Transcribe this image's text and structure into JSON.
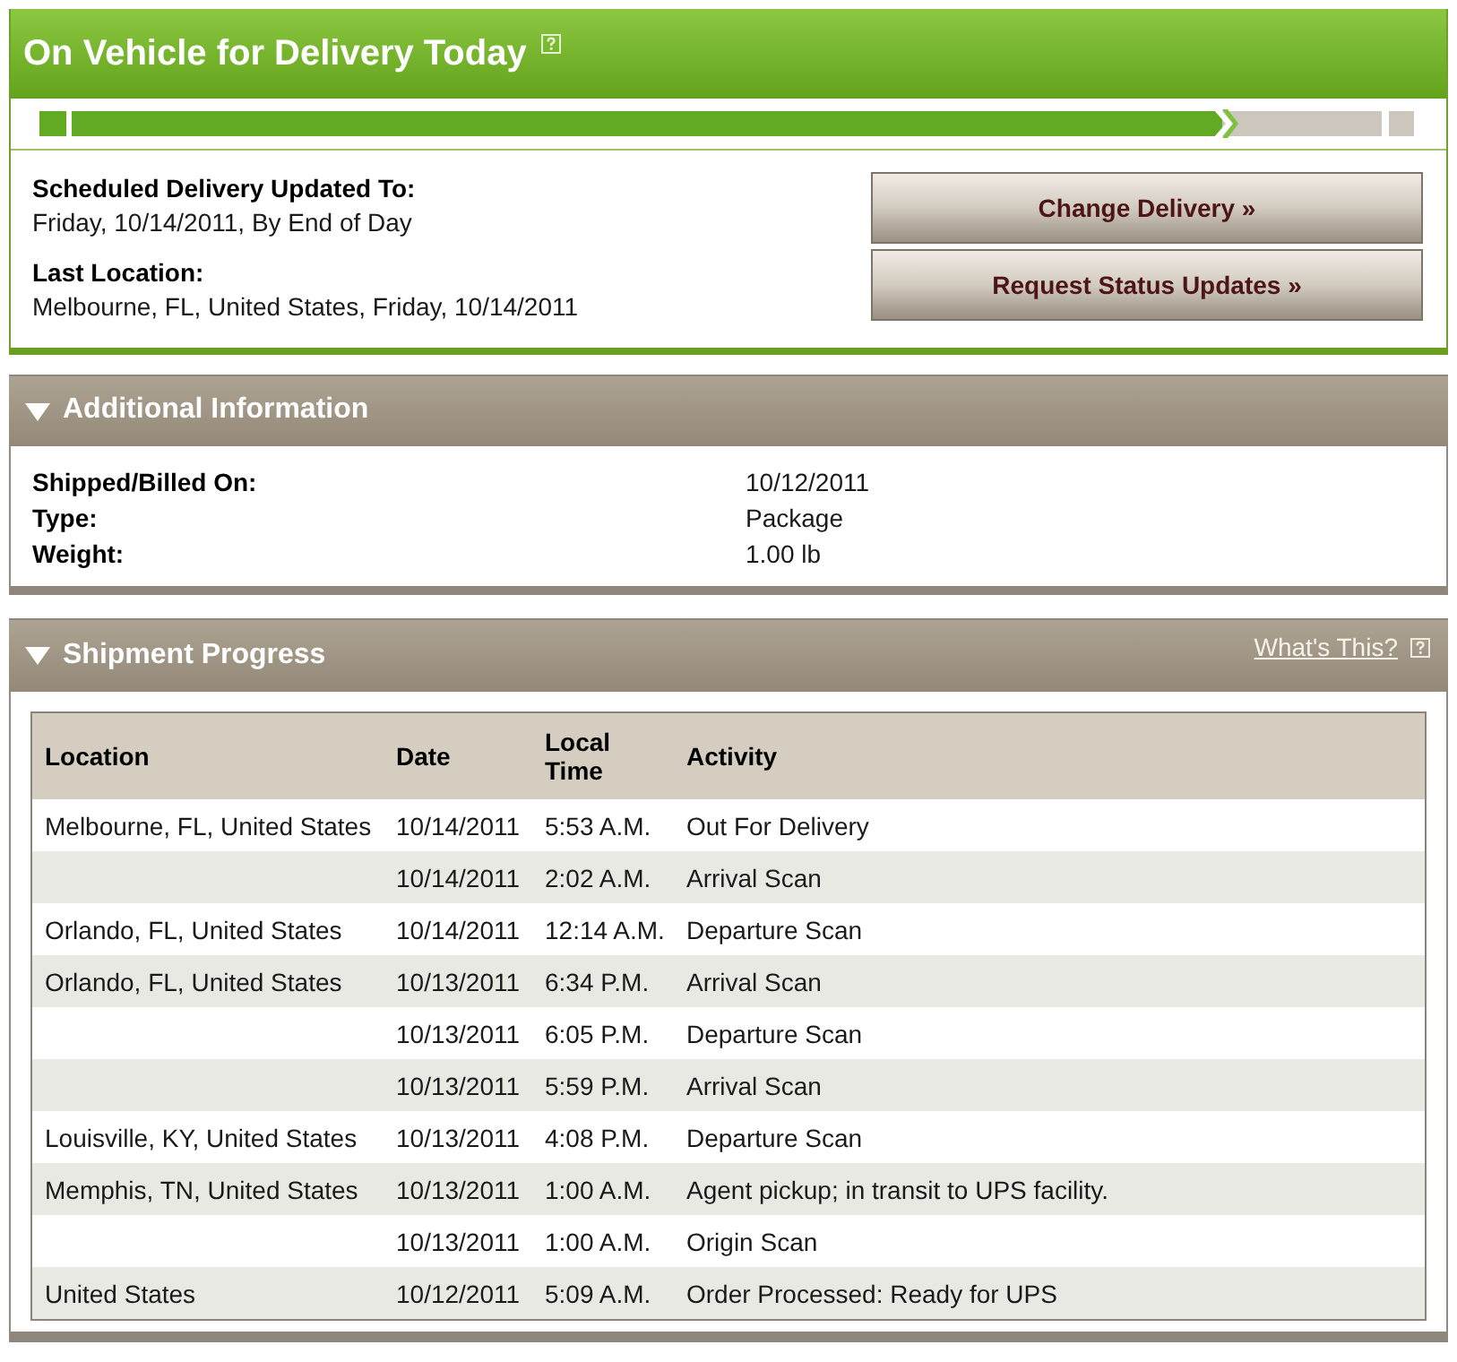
{
  "status": {
    "title": "On Vehicle for Delivery Today",
    "progress": {
      "level": 0.86
    }
  },
  "delivery_details": [
    {
      "label": "Scheduled Delivery Updated To:",
      "value": "Friday, 10/14/2011, By End of Day"
    },
    {
      "label": "Last Location:",
      "value": "Melbourne, FL, United States, Friday, 10/14/2011"
    }
  ],
  "buttons": [
    "Change Delivery »",
    "Request Status Updates »"
  ],
  "additional_information": {
    "title": "Additional Information",
    "expanded": true,
    "rows": [
      {
        "label": "Shipped/Billed On:",
        "value": "10/12/2011"
      },
      {
        "label": "Type:",
        "value": "Package"
      },
      {
        "label": "Weight:",
        "value": "1.00 lb"
      }
    ]
  },
  "shipment_progress": {
    "title": "Shipment Progress",
    "expanded": true,
    "help_link": "What's This?",
    "table": {
      "columns": [
        "Location",
        "Date",
        "Local Time",
        "Activity"
      ],
      "rows": [
        {
          "location": "Melbourne, FL, United States",
          "date": "10/14/2011",
          "time": "5:53 A.M.",
          "activity": "Out For Delivery"
        },
        {
          "date": "10/14/2011",
          "time": "2:02 A.M.",
          "activity": "Arrival Scan"
        },
        {
          "location": "Orlando, FL, United States",
          "date": "10/14/2011",
          "time": "12:14 A.M.",
          "activity": "Departure Scan"
        },
        {
          "location": "Orlando, FL, United States",
          "date": "10/13/2011",
          "time": "6:34 P.M.",
          "activity": "Arrival Scan"
        },
        {
          "date": "10/13/2011",
          "time": "6:05 P.M.",
          "activity": "Departure Scan"
        },
        {
          "date": "10/13/2011",
          "time": "5:59 P.M.",
          "activity": "Arrival Scan"
        },
        {
          "location": "Louisville, KY, United States",
          "date": "10/13/2011",
          "time": "4:08 P.M.",
          "activity": "Departure Scan"
        },
        {
          "location": "Memphis, TN, United States",
          "date": "10/13/2011",
          "time": "1:00 A.M.",
          "activity": "Agent pickup; in transit to UPS facility."
        },
        {
          "date": "10/13/2011",
          "time": "1:00 A.M.",
          "activity": "Origin Scan"
        },
        {
          "location": "United States",
          "date": "10/12/2011",
          "time": "5:09 A.M.",
          "activity": "Order Processed: Ready for UPS"
        }
      ]
    }
  }
}
